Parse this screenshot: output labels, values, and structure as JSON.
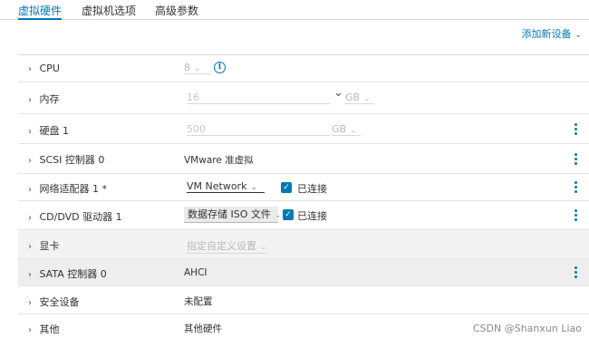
{
  "tabs": [
    {
      "label": "虚拟硬件",
      "active": true
    },
    {
      "label": "虚拟机选项",
      "active": false
    },
    {
      "label": "高级参数",
      "active": false
    }
  ],
  "add_device": {
    "label": "添加新设备",
    "chevron": "⌄"
  },
  "rows": {
    "cpu": {
      "label": "CPU",
      "value": "8"
    },
    "memory": {
      "label": "内存",
      "value": "16",
      "unit": "GB"
    },
    "disk": {
      "label": "硬盘 1",
      "value": "500",
      "unit": "GB"
    },
    "scsi": {
      "label": "SCSI 控制器 0",
      "value": "VMware 准虚拟"
    },
    "network": {
      "label": "网络适配器 1 *",
      "value": "VM Network",
      "connected_label": "已连接",
      "connected": true
    },
    "cddvd": {
      "label": "CD/DVD 驱动器 1",
      "value": "数据存储 ISO 文件",
      "connected_label": "已连接",
      "connected": true
    },
    "gpu": {
      "label": "显卡",
      "value": "指定自定义设置"
    },
    "sata": {
      "label": "SATA 控制器 0",
      "value": "AHCI"
    },
    "security": {
      "label": "安全设备",
      "value": "未配置"
    },
    "other": {
      "label": "其他",
      "value": "其他硬件"
    }
  },
  "watermark": "CSDN @Shanxun Liao",
  "colors": {
    "accent": "#0079b8",
    "disabled": "#b8b8b8",
    "shaded_row": "#f3f3f3"
  },
  "icons": {
    "expand": "chevron-right-icon",
    "info": "info-icon",
    "more": "vertical-ellipsis-icon",
    "check": "checkbox-checked-icon"
  }
}
